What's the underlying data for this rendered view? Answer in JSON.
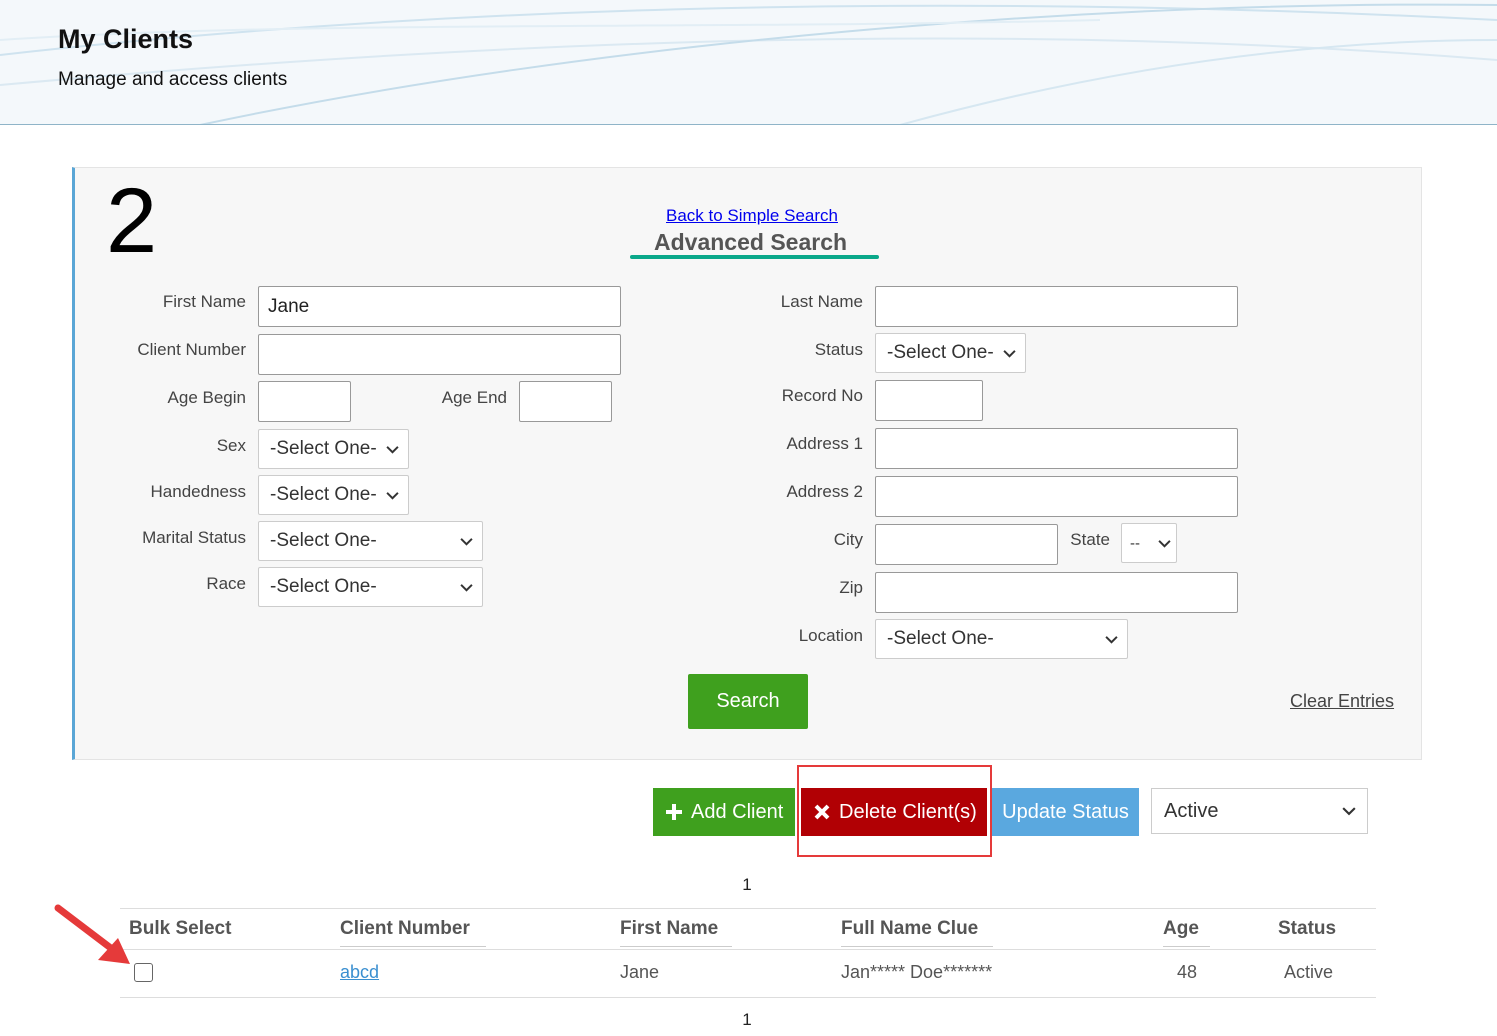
{
  "header": {
    "title": "My Clients",
    "subtitle": "Manage and access clients"
  },
  "panel": {
    "step_number": "2",
    "back_link": "Back to Simple Search",
    "title": "Advanced Search",
    "left_fields": {
      "first_name": {
        "label": "First Name",
        "value": "Jane"
      },
      "client_number": {
        "label": "Client Number",
        "value": ""
      },
      "age_begin": {
        "label": "Age Begin",
        "value": ""
      },
      "age_end": {
        "label": "Age End",
        "value": ""
      },
      "sex": {
        "label": "Sex",
        "value": "-Select One-"
      },
      "handedness": {
        "label": "Handedness",
        "value": "-Select One-"
      },
      "marital_status": {
        "label": "Marital Status",
        "value": "-Select One-"
      },
      "race": {
        "label": "Race",
        "value": "-Select One-"
      }
    },
    "right_fields": {
      "last_name": {
        "label": "Last Name",
        "value": ""
      },
      "status": {
        "label": "Status",
        "value": "-Select One-"
      },
      "record_no": {
        "label": "Record No",
        "value": ""
      },
      "address1": {
        "label": "Address 1",
        "value": ""
      },
      "address2": {
        "label": "Address 2",
        "value": ""
      },
      "city": {
        "label": "City",
        "value": ""
      },
      "state": {
        "label": "State",
        "value": "--"
      },
      "zip": {
        "label": "Zip",
        "value": ""
      },
      "location": {
        "label": "Location",
        "value": "-Select One-"
      }
    },
    "search_button": "Search",
    "clear_link": "Clear Entries"
  },
  "actions": {
    "add_client": "Add Client",
    "delete_clients": "Delete Client(s)",
    "update_status": "Update Status",
    "status_value": "Active"
  },
  "pager": {
    "top": "1",
    "bottom": "1"
  },
  "table": {
    "columns": [
      "Bulk Select",
      "Client Number",
      "First Name",
      "Full Name Clue",
      "Age",
      "Status"
    ],
    "rows": [
      {
        "client_number": "abcd",
        "first_name": "Jane",
        "full_name_clue": "Jan***** Doe*******",
        "age": "48",
        "status": "Active"
      }
    ]
  },
  "colors": {
    "green": "#3fa01e",
    "red": "#b10004",
    "blue": "#5aa8df",
    "accent_underline": "#0aa88a",
    "annotation_red": "#e53a3a"
  }
}
